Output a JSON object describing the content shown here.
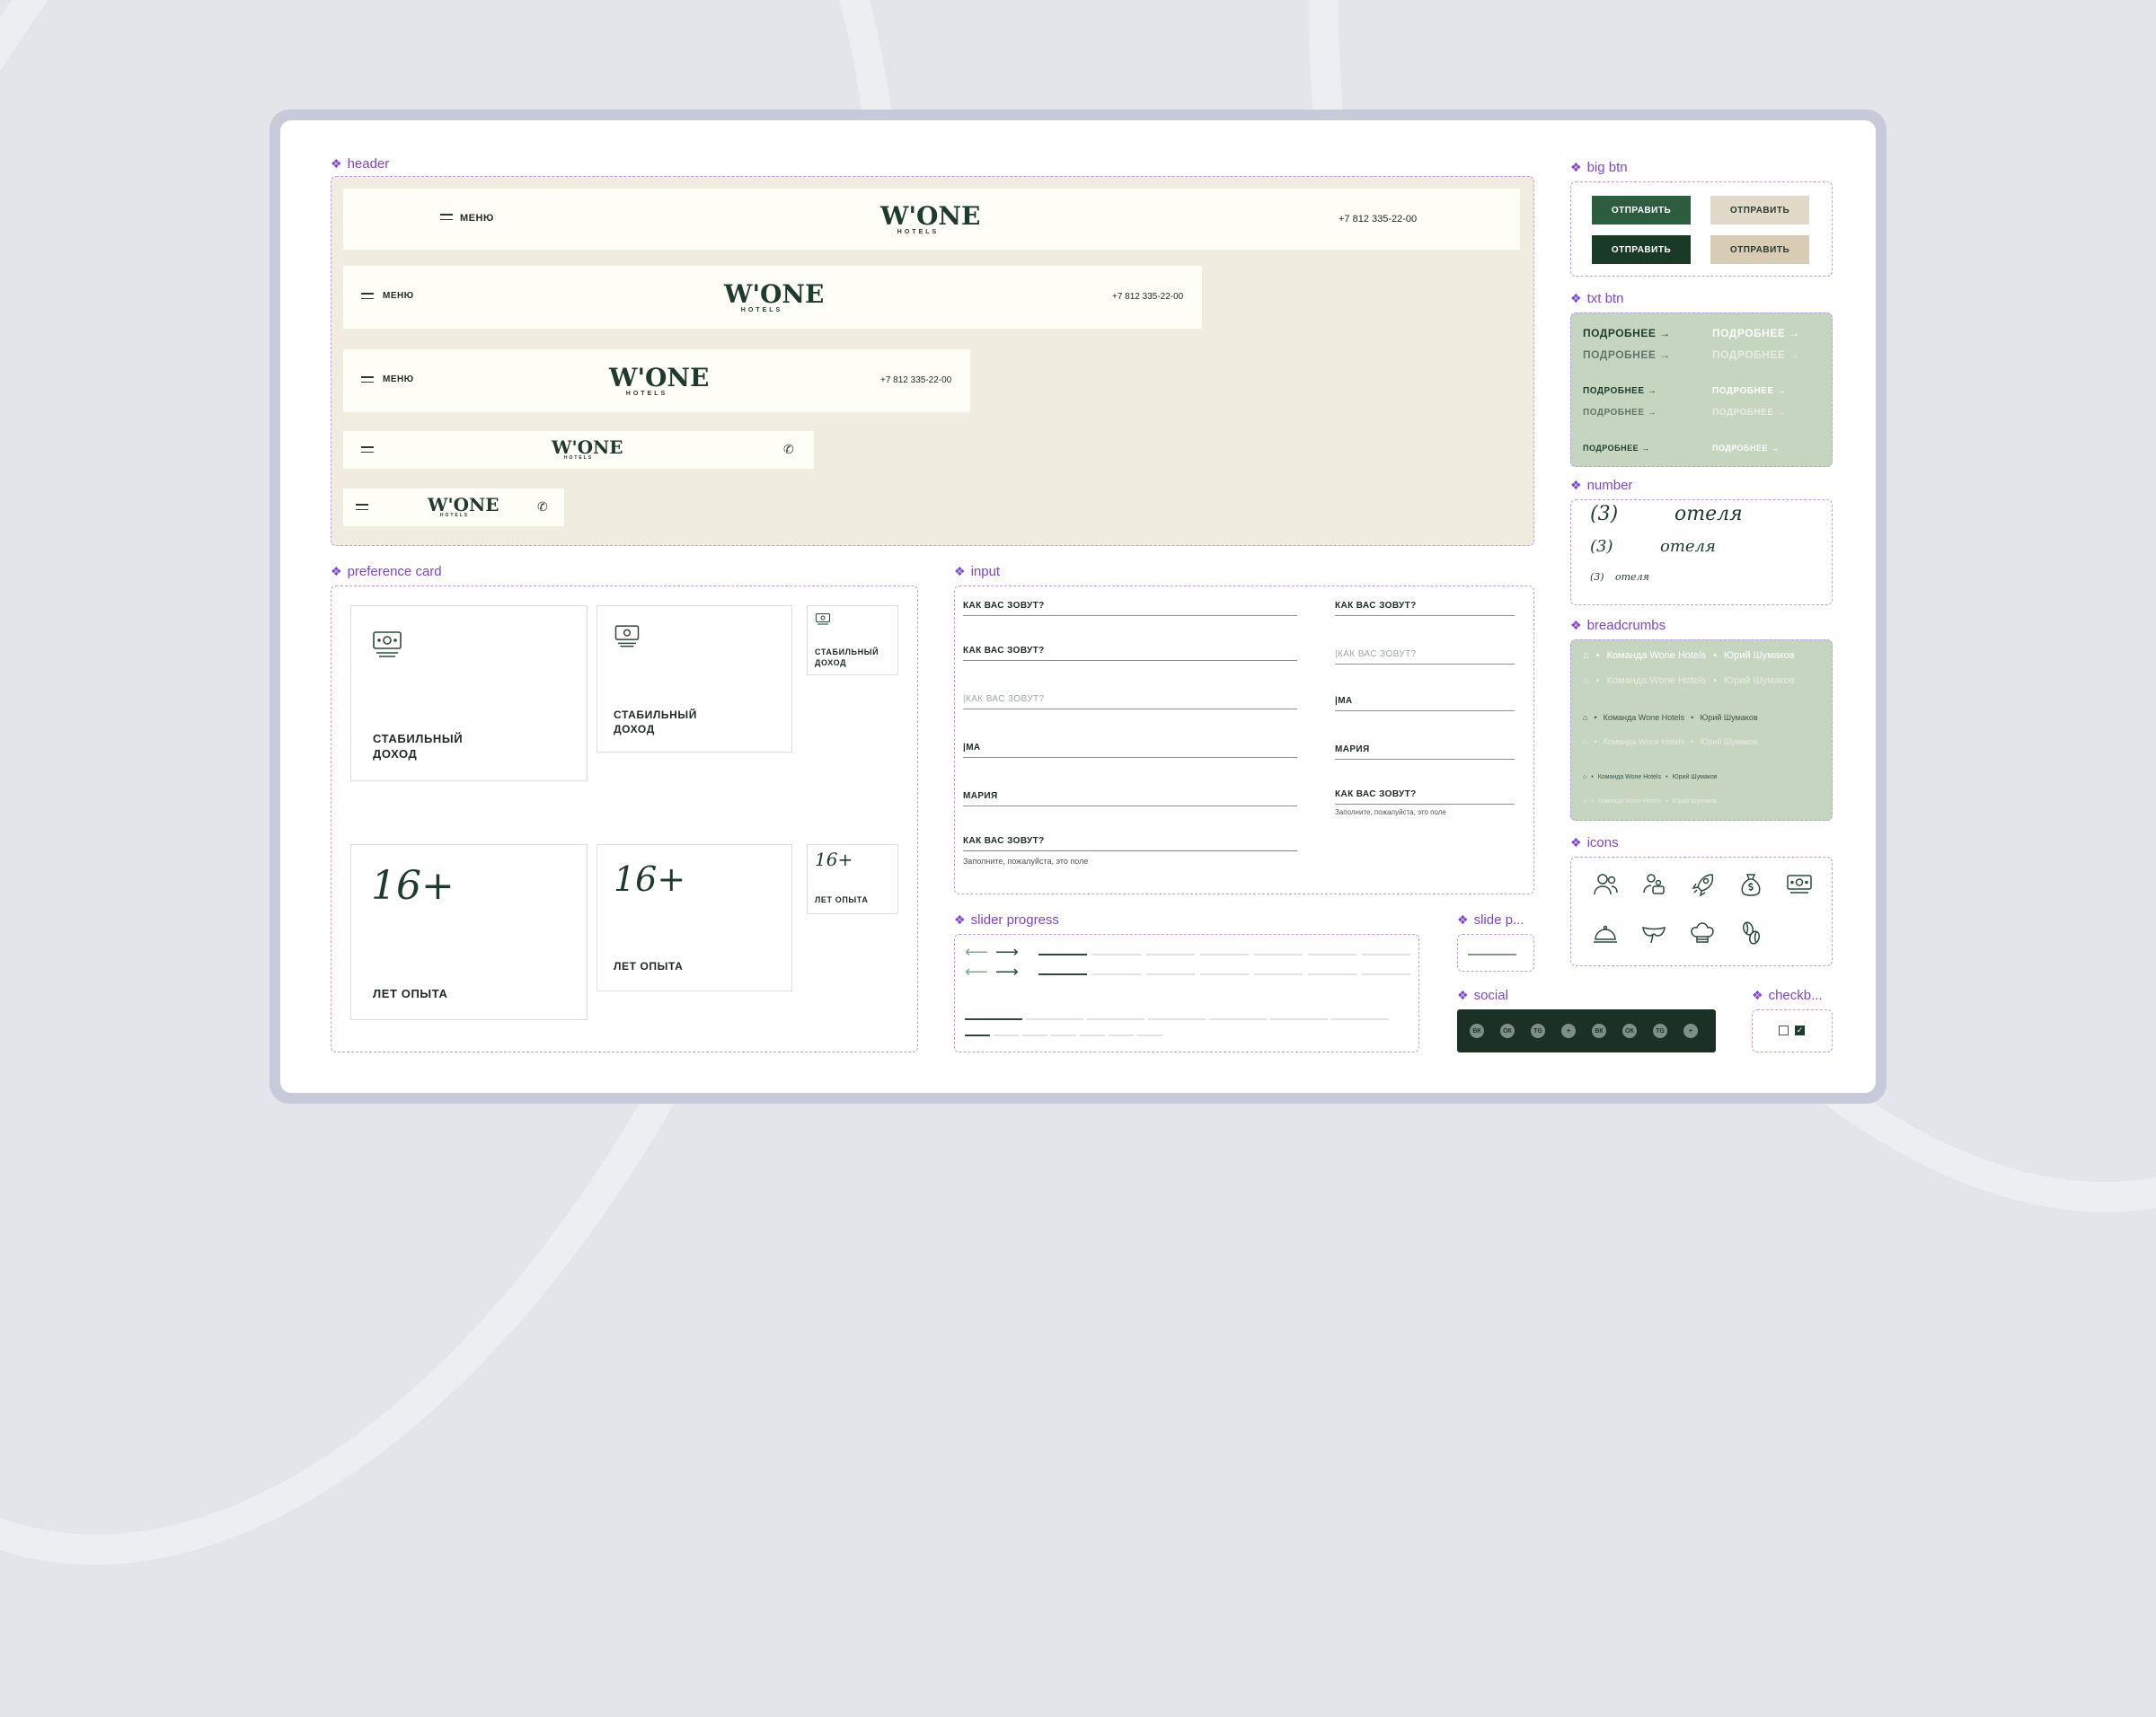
{
  "sections": {
    "header": "header",
    "preference_card": "preference card",
    "input": "input",
    "slider_progress": "slider progress",
    "slide_p": "slide p...",
    "social": "social",
    "big_btn": "big btn",
    "txt_btn": "txt btn",
    "number": "number",
    "breadcrumbs": "breadcrumbs",
    "icons": "icons",
    "checkbox": "checkb..."
  },
  "header": {
    "menu_label": "МЕНЮ",
    "phone": "+7 812 335-22-00",
    "logo_word": "W'ONE",
    "logo_sub": "HOTELS"
  },
  "preference_card": {
    "income_line1": "СТАБИЛЬНЫЙ",
    "income_line2": "ДОХОД",
    "years_value": "16+",
    "years_label": "ЛЕТ ОПЫТА"
  },
  "input": {
    "label": "КАК ВАС ЗОВУТ?",
    "placeholder": "|КАК ВАС ЗОВУТ?",
    "typing": "|МА",
    "value": "МАРИЯ",
    "error": "Заполните, пожалуйста, это поле"
  },
  "big_btn": {
    "label": "ОТПРАВИТЬ"
  },
  "txt_btn": {
    "label": "ПОДРОБНЕЕ"
  },
  "number": {
    "value": "(3)",
    "word": "отеля"
  },
  "breadcrumbs": {
    "item1": "Команда Wone Hotels",
    "item2": "Юрий Шумаков"
  },
  "social": [
    "ВК",
    "ОК",
    "TG",
    "+",
    "ВК",
    "ОК",
    "TG",
    "+"
  ],
  "colors": {
    "accent": "#7a45d8",
    "brand_green": "#2c5d41",
    "dark_green": "#183a26",
    "beige": "#e2dac8",
    "sage": "#c6d5c0",
    "header_bg": "#f0ece0",
    "social_bg": "#1b3126"
  }
}
